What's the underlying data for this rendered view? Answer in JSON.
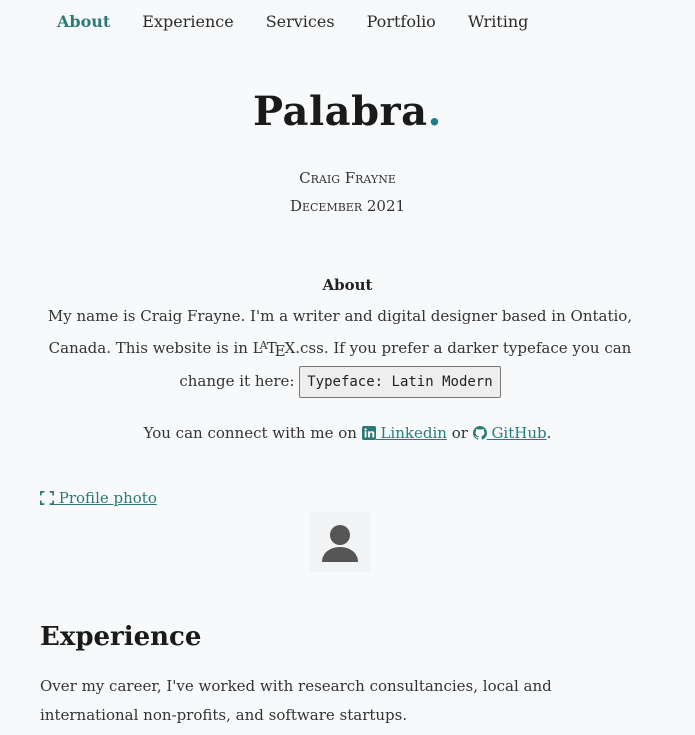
{
  "nav": {
    "items": [
      "About",
      "Experience",
      "Services",
      "Portfolio",
      "Writing"
    ],
    "active": "About"
  },
  "header": {
    "title": "Palabra",
    "title_dot": ".",
    "author": "Craig Frayne",
    "date": "December 2021"
  },
  "about": {
    "heading": "About",
    "text_before": "My name is Craig Frayne. I'm a writer and digital designer based in Ontatio, Canada. This website is in ",
    "latex_label": "LATEX",
    "text_after": ".css. If you prefer a darker typeface you can change it here: ",
    "typeface_button": "Typeface: Latin Modern"
  },
  "connect": {
    "prefix": "You can connect with me on ",
    "linkedin": " Linkedin",
    "or": " or ",
    "github": " GitHub",
    "suffix": "."
  },
  "photo": {
    "link_label": " Profile photo",
    "avatar_icon": "person-icon"
  },
  "experience": {
    "heading": "Experience",
    "text": "Over my career, I've worked with research consultancies, local and international non-profits, and software startups."
  },
  "colors": {
    "accent": "#2b7a78",
    "background": "#f8f9fa"
  }
}
